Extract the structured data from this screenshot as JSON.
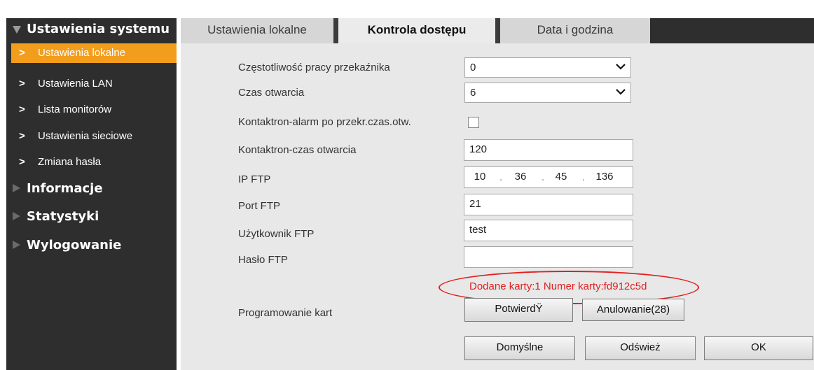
{
  "sidebar": {
    "system_settings": "Ustawienia systemu",
    "items": [
      {
        "label": "Ustawienia lokalne",
        "active": true
      },
      {
        "label": "Ustawienia LAN",
        "active": false
      },
      {
        "label": "Lista monitorów",
        "active": false
      },
      {
        "label": "Ustawienia sieciowe",
        "active": false
      },
      {
        "label": "Zmiana hasła",
        "active": false
      }
    ],
    "info": "Informacje",
    "stats": "Statystyki",
    "logout": "Wylogowanie",
    "arrow_glyph": ">"
  },
  "tabs": [
    {
      "label": "Ustawienia lokalne",
      "active": false
    },
    {
      "label": "Kontrola dostępu",
      "active": true
    },
    {
      "label": "Data i godzina",
      "active": false
    }
  ],
  "form": {
    "relay_freq": {
      "label": "Częstotliwość pracy przekaźnika",
      "value": "0"
    },
    "open_time": {
      "label": "Czas otwarcia",
      "value": "6"
    },
    "contact_alarm": {
      "label": "Kontaktron-alarm po przekr.czas.otw.",
      "checked": false
    },
    "contact_time": {
      "label": "Kontaktron-czas otwarcia",
      "value": "120"
    },
    "ftp_ip": {
      "label": "IP FTP",
      "octets": [
        "10",
        "36",
        "45",
        "136"
      ]
    },
    "ftp_port": {
      "label": "Port FTP",
      "value": "21"
    },
    "ftp_user": {
      "label": "Użytkownik FTP",
      "value": "test"
    },
    "ftp_pass": {
      "label": "Hasło FTP",
      "value": ""
    },
    "card_message": "Dodane karty:1 Numer karty:fd912c5d",
    "card_programming": {
      "label": "Programowanie kart",
      "confirm": "PotwierdŸ",
      "cancel": "Anulowanie(28)"
    }
  },
  "buttons": {
    "default": "Domyślne",
    "refresh": "Odśwież",
    "ok": "OK"
  },
  "colors": {
    "sidebar_bg": "#2e2e2e",
    "active_item": "#f29d1c",
    "panel_bg": "#e8e8e8",
    "message_red": "#e02020"
  }
}
